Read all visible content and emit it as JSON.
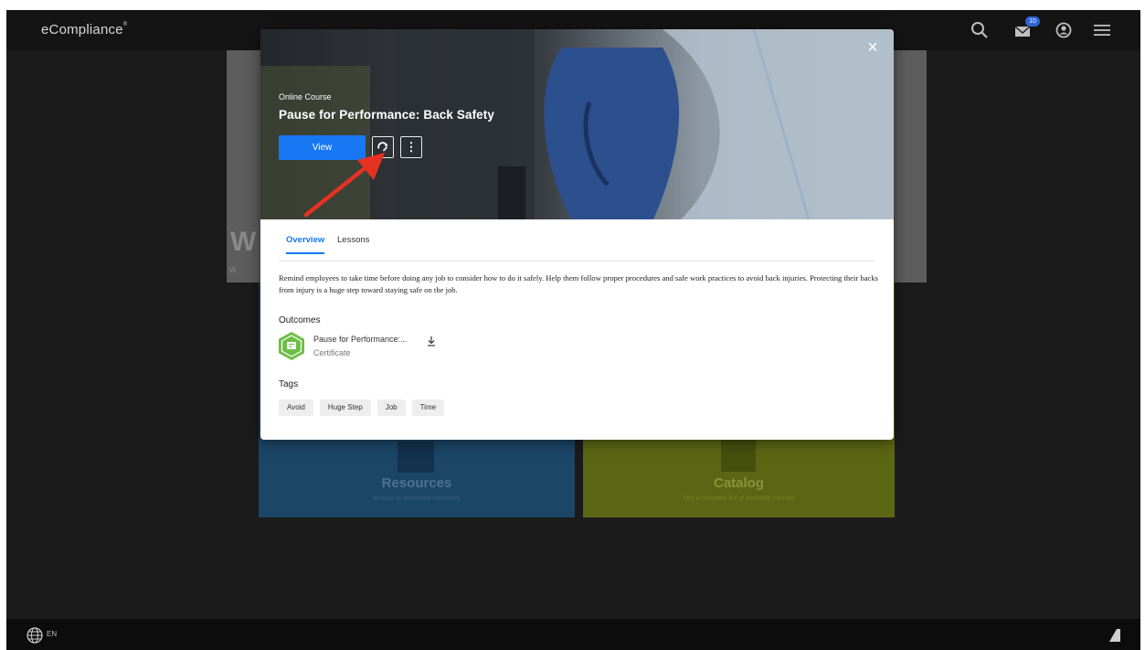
{
  "brand": {
    "name": "eCompliance"
  },
  "topbar": {
    "mail_count": "10"
  },
  "footer": {
    "language": "EN"
  },
  "background": {
    "hero_letter": "W",
    "hero_sub": "W",
    "tiles": [
      {
        "title": "Resources",
        "subtitle": "Browse or download resources"
      },
      {
        "title": "Catalog",
        "subtitle": "See a complete list of available courses"
      }
    ]
  },
  "modal": {
    "close_label": "×",
    "course_type": "Online Course",
    "course_title": "Pause for Performance: Back Safety",
    "view_label": "View",
    "more_label": "⋮",
    "tabs": [
      {
        "label": "Overview"
      },
      {
        "label": "Lessons"
      }
    ],
    "active_tab": "Overview",
    "description": "Remind employees to take time before doing any job to consider how to do it safely. Help them follow proper procedures and safe work practices to avoid back injuries. Protecting their backs from injury is a huge step toward staying safe on the job.",
    "outcomes_heading": "Outcomes",
    "outcome": {
      "name": "Pause for Performance:...",
      "type": "Certificate"
    },
    "tags_heading": "Tags",
    "tags": [
      "Avoid",
      "Huge Step",
      "Job",
      "Time"
    ]
  },
  "colors": {
    "accent": "#1877f2",
    "certificate": "#6cbf47",
    "annotation": "#e63222",
    "resources_tile": "#1c4666",
    "catalog_tile": "#5a6614"
  }
}
